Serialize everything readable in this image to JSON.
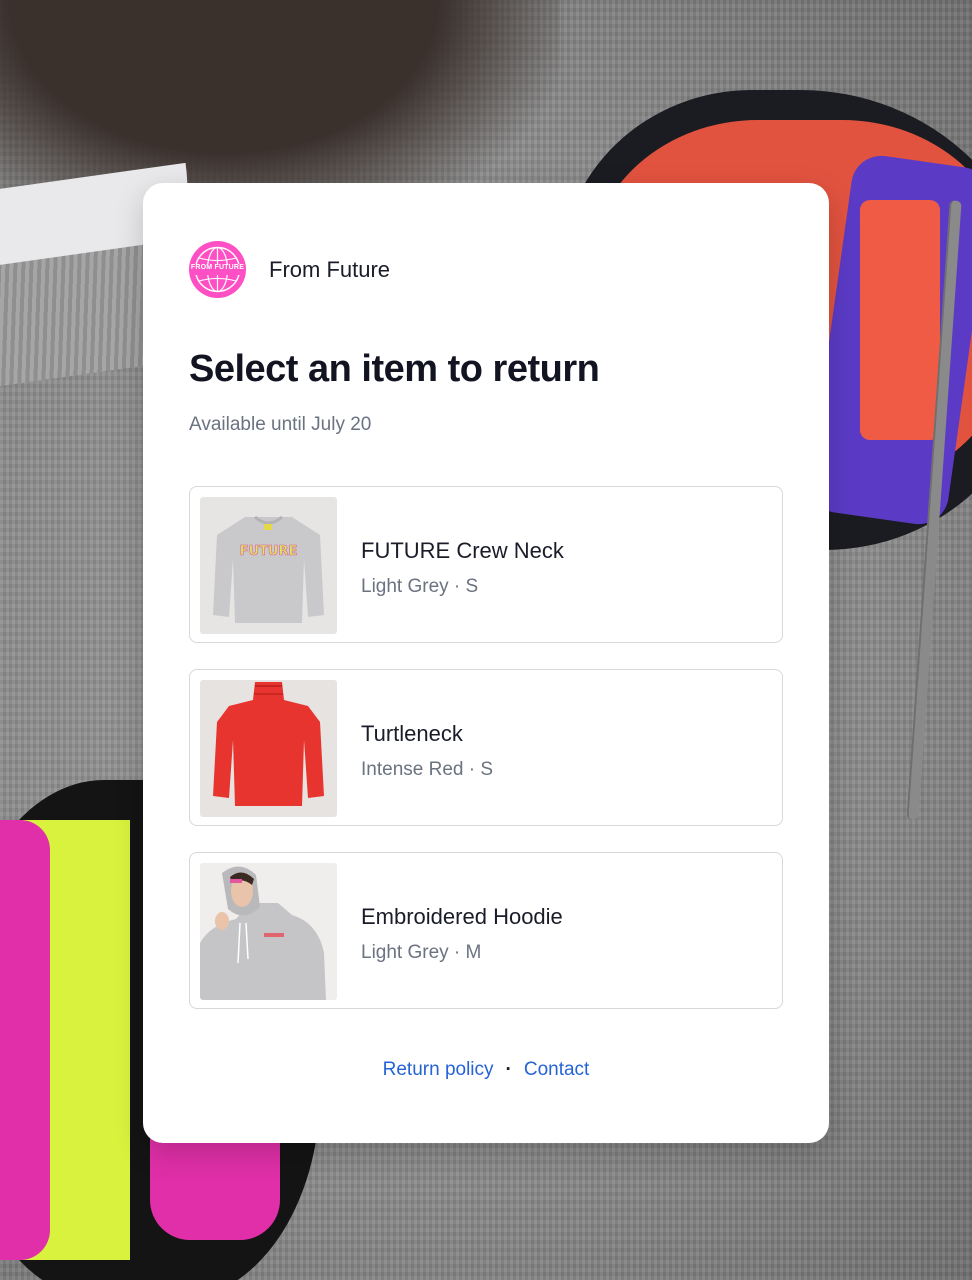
{
  "brand": {
    "name": "From Future",
    "logo_text": "FROM FUTURE",
    "logo_color": "#ff4fc4"
  },
  "page": {
    "title": "Select an item to return",
    "subtitle": "Available until July 20"
  },
  "items": [
    {
      "name": "FUTURE Crew Neck",
      "meta": "Light Grey · S",
      "thumb_color": "#c9c9cb",
      "print": "FUTURE"
    },
    {
      "name": "Turtleneck",
      "meta": "Intense Red · S",
      "thumb_color": "#e8342e"
    },
    {
      "name": "Embroidered Hoodie",
      "meta": "Light Grey · M",
      "thumb_color": "#c5c5c7"
    }
  ],
  "footer": {
    "return_policy": "Return policy",
    "separator": "·",
    "contact": "Contact",
    "link_color": "#2563d6"
  }
}
